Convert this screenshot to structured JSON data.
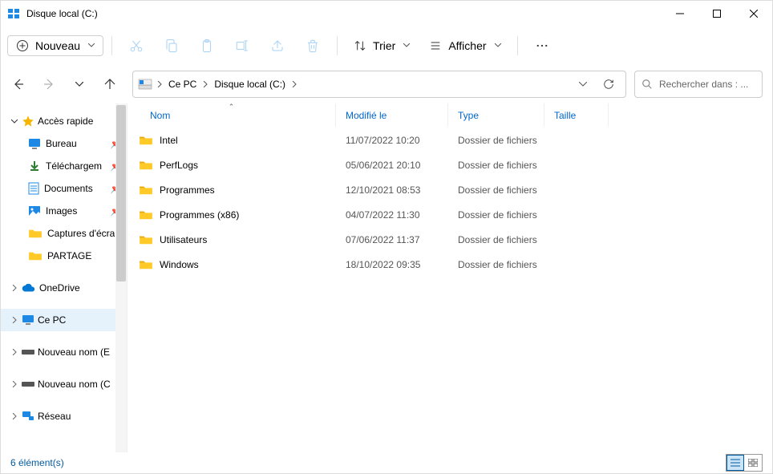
{
  "window": {
    "title": "Disque local (C:)"
  },
  "toolbar": {
    "new": "Nouveau",
    "sort": "Trier",
    "view": "Afficher"
  },
  "breadcrumb": {
    "root": "Ce PC",
    "loc": "Disque local (C:)"
  },
  "search": {
    "placeholder": "Rechercher dans : ..."
  },
  "sidebar": {
    "quick": "Accès rapide",
    "quick_items": [
      {
        "label": "Bureau",
        "icon": "desktop"
      },
      {
        "label": "Téléchargem",
        "icon": "download"
      },
      {
        "label": "Documents",
        "icon": "document"
      },
      {
        "label": "Images",
        "icon": "pictures"
      },
      {
        "label": "Captures d'écra",
        "icon": "folder"
      },
      {
        "label": "PARTAGE",
        "icon": "folder"
      }
    ],
    "onedrive": "OneDrive",
    "cepc": "Ce PC",
    "nn1": "Nouveau nom (E",
    "nn2": "Nouveau nom (C",
    "reseau": "Réseau"
  },
  "columns": {
    "name": "Nom",
    "modified": "Modifié le",
    "type": "Type",
    "size": "Taille"
  },
  "rows": [
    {
      "name": "Intel",
      "modified": "11/07/2022 10:20",
      "type": "Dossier de fichiers"
    },
    {
      "name": "PerfLogs",
      "modified": "05/06/2021 20:10",
      "type": "Dossier de fichiers"
    },
    {
      "name": "Programmes",
      "modified": "12/10/2021 08:53",
      "type": "Dossier de fichiers"
    },
    {
      "name": "Programmes (x86)",
      "modified": "04/07/2022 11:30",
      "type": "Dossier de fichiers"
    },
    {
      "name": "Utilisateurs",
      "modified": "07/06/2022 11:37",
      "type": "Dossier de fichiers"
    },
    {
      "name": "Windows",
      "modified": "18/10/2022 09:35",
      "type": "Dossier de fichiers"
    }
  ],
  "status": {
    "count": "6 élément(s)"
  }
}
